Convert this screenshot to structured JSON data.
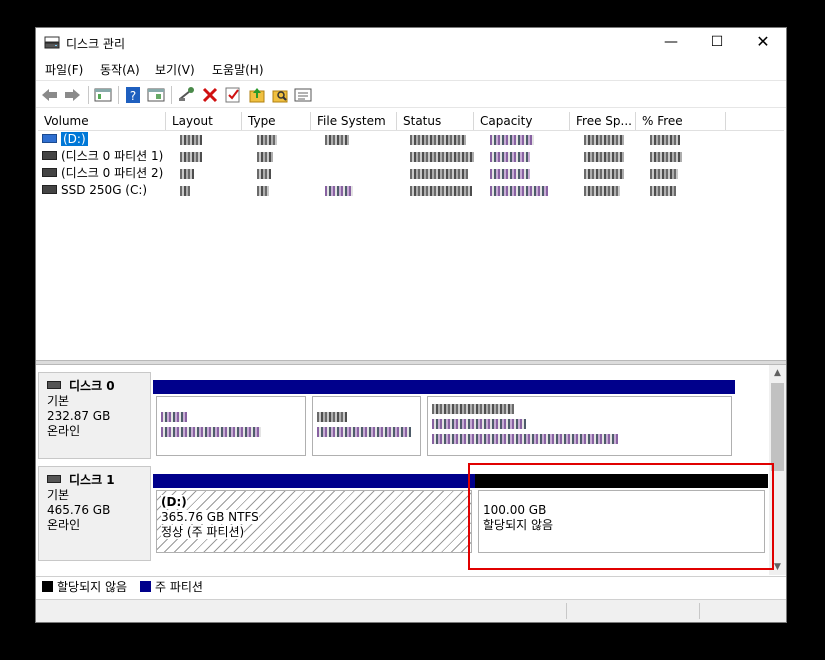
{
  "window": {
    "title": "디스크 관리"
  },
  "menu": [
    "파일(F)",
    "동작(A)",
    "보기(V)",
    "도움말(H)"
  ],
  "toolbar": [
    "back-icon",
    "forward-icon",
    "properties-icon",
    "help-icon",
    "console-icon",
    "connect-icon",
    "delete-icon",
    "check-icon",
    "folder-up-icon",
    "folder-search-icon",
    "list-icon"
  ],
  "columns": [
    "Volume",
    "Layout",
    "Type",
    "File System",
    "Status",
    "Capacity",
    "Free Sp...",
    "% Free"
  ],
  "volumes": [
    {
      "name": "(D:)"
    },
    {
      "name": "(디스크 0 파티션 1)"
    },
    {
      "name": "(디스크 0 파티션 2)"
    },
    {
      "name": "SSD 250G (C:)"
    }
  ],
  "disks": [
    {
      "name": "디스크 0",
      "type": "기본",
      "size": "232.87 GB",
      "state": "온라인"
    },
    {
      "name": "디스크 1",
      "type": "기본",
      "size": "465.76 GB",
      "state": "온라인",
      "partitions": [
        {
          "label": "(D:)",
          "size_fs": "365.76 GB NTFS",
          "status": "정상 (주 파티션)"
        },
        {
          "size": "100.00 GB",
          "status": "할당되지 않음"
        }
      ]
    }
  ],
  "legend": [
    {
      "label": "할당되지 않음",
      "color": "#000000"
    },
    {
      "label": "주 파티션",
      "color": "#00008b"
    }
  ]
}
